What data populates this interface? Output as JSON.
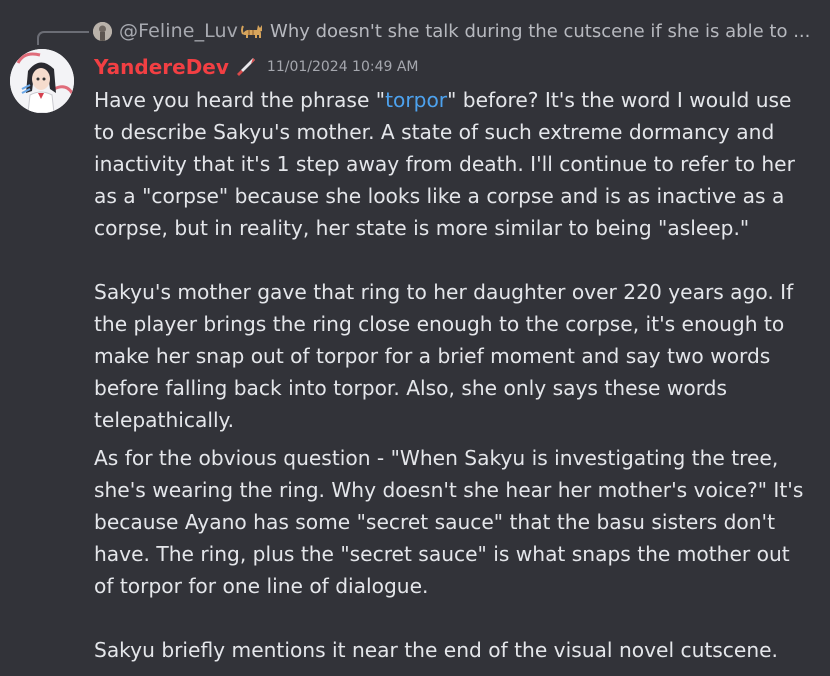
{
  "reply": {
    "author": "@Feline_Luv",
    "author_icon": "cat-emoji-icon",
    "text": "Why doesn't she talk during the cutscene if she is able to ..."
  },
  "message": {
    "author": "YandereDev",
    "author_color": "#f23f43",
    "role_icon": "knife-icon",
    "timestamp": "11/01/2024 10:49 AM",
    "p1": {
      "before": "Have you heard the phrase \"",
      "link": "torpor",
      "after": "\" before? It's the word I would use to describe Sakyu's mother. A state of such extreme dormancy and inactivity that it's 1 step away from death. I'll continue to refer to her as a \"corpse\" because she looks like a corpse and is as inactive as a corpse, but in reality, her state is more similar to being \"asleep.\""
    },
    "p2": "Sakyu's mother gave that ring to her daughter over 220 years ago. If the player brings the ring close enough to the corpse, it's enough to make her snap out of torpor for a brief moment and say two words before falling back into torpor. Also, she only says these words telepathically.",
    "p3": "As for the obvious question - \"When Sakyu is investigating the tree, she's wearing the ring. Why doesn't she hear her mother's voice?\" It's because Ayano has some \"secret sauce\" that the basu sisters don't have. The ring, plus the \"secret sauce\" is what snaps the mother out of torpor for one line of dialogue.",
    "p4": "Sakyu briefly mentions it near the end of the visual novel cutscene."
  },
  "colors": {
    "background": "#323339",
    "text": "#e4e6ea",
    "link": "#4da2ee",
    "muted": "#a5a7ae"
  }
}
